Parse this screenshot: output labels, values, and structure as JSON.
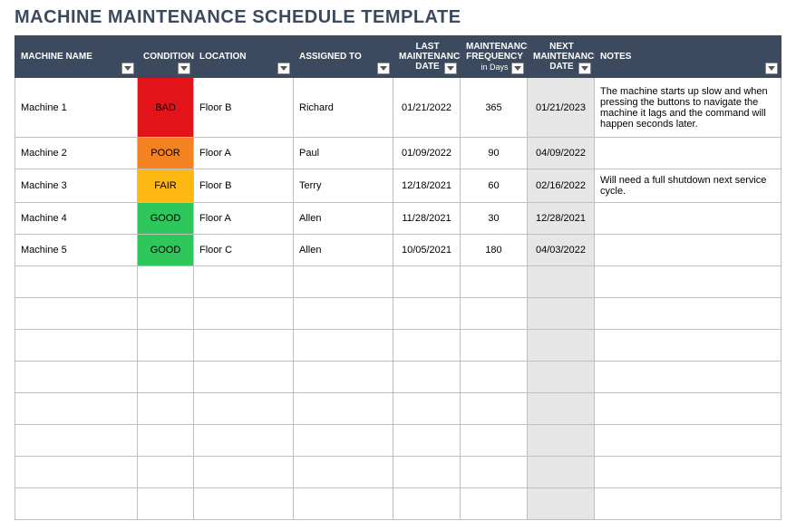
{
  "title": "MACHINE MAINTENANCE SCHEDULE TEMPLATE",
  "columns": {
    "machine_name": "MACHINE NAME",
    "condition": "CONDITION",
    "location": "LOCATION",
    "assigned_to": "ASSIGNED TO",
    "last_maint": "LAST MAINTENANCE DATE",
    "freq": "MAINTENANCE FREQUENCY",
    "freq_sub": "in Days",
    "next_maint": "NEXT MAINTENANCE DATE",
    "notes": "NOTES"
  },
  "condition_colors": {
    "BAD": "#e3131a",
    "POOR": "#f58220",
    "FAIR": "#fdb813",
    "GOOD": "#2ec75b"
  },
  "rows": [
    {
      "machine_name": "Machine 1",
      "condition": "BAD",
      "location": "Floor B",
      "assigned_to": "Richard",
      "last_maint": "01/21/2022",
      "freq": "365",
      "next_maint": "01/21/2023",
      "notes": "The machine starts up slow and when pressing the buttons to navigate the machine it lags and the command will happen seconds later."
    },
    {
      "machine_name": "Machine 2",
      "condition": "POOR",
      "location": "Floor A",
      "assigned_to": "Paul",
      "last_maint": "01/09/2022",
      "freq": "90",
      "next_maint": "04/09/2022",
      "notes": ""
    },
    {
      "machine_name": "Machine 3",
      "condition": "FAIR",
      "location": "Floor B",
      "assigned_to": "Terry",
      "last_maint": "12/18/2021",
      "freq": "60",
      "next_maint": "02/16/2022",
      "notes": "Will need a full shutdown next service cycle."
    },
    {
      "machine_name": "Machine 4",
      "condition": "GOOD",
      "location": "Floor A",
      "assigned_to": "Allen",
      "last_maint": "11/28/2021",
      "freq": "30",
      "next_maint": "12/28/2021",
      "notes": ""
    },
    {
      "machine_name": "Machine 5",
      "condition": "GOOD",
      "location": "Floor C",
      "assigned_to": "Allen",
      "last_maint": "10/05/2021",
      "freq": "180",
      "next_maint": "04/03/2022",
      "notes": ""
    }
  ],
  "empty_rows": 8
}
